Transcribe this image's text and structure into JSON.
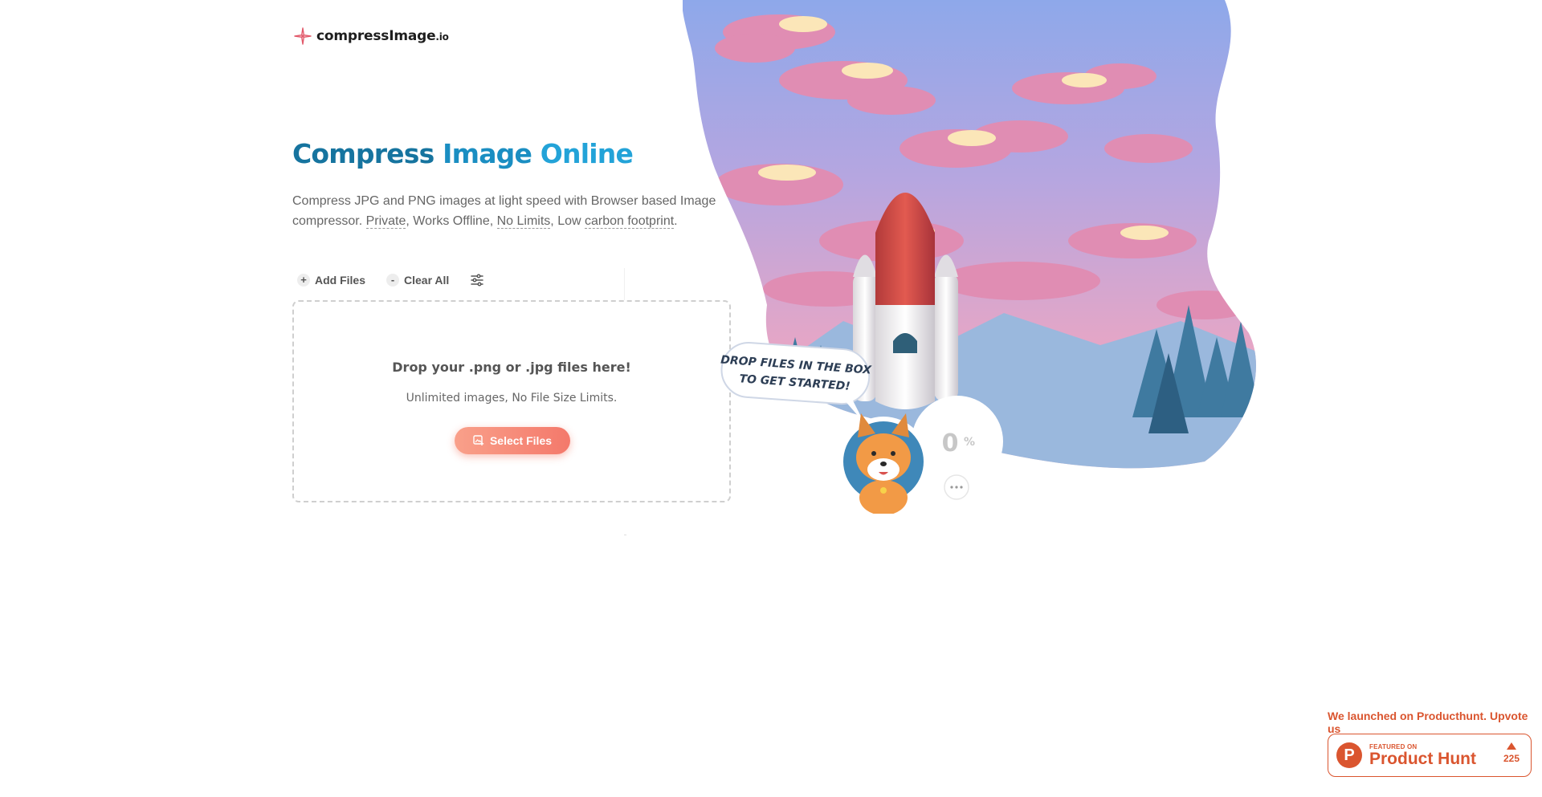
{
  "header": {
    "logo_name": "compressImage",
    "logo_tld": ".io",
    "logo_icon": "sparkle-icon"
  },
  "hero": {
    "title_word1": "Compress",
    "title_word2": "Image",
    "title_word3": "Online",
    "desc_1": "Compress JPG and PNG images at light speed with Browser based Image compressor. ",
    "desc_private": "Private",
    "desc_2": ", Works Offline, ",
    "desc_nolimits": "No Limits",
    "desc_3": ", Low ",
    "desc_carbon": "carbon footprint",
    "desc_4": "."
  },
  "toolbar": {
    "add_symbol": "+",
    "add_label": "Add Files",
    "clear_symbol": "-",
    "clear_label": "Clear All",
    "settings_icon": "sliders-icon"
  },
  "dropzone": {
    "title": "Drop your .png or .jpg files here!",
    "subtitle": "Unlimited images, No File Size Limits.",
    "select_label": "Select Files",
    "select_icon": "image-add-icon"
  },
  "illustration": {
    "bubble_line1": "DROP FILES IN THE BOX",
    "bubble_line2": "TO GET STARTED!",
    "progress_value": "0",
    "progress_unit": "%",
    "more_icon": "ellipsis-icon",
    "mascot": "corgi-mascot"
  },
  "producthunt": {
    "announce": "We launched on Producthunt. Upvote us",
    "badge_letter": "P",
    "featured": "FEATURED ON",
    "name": "Product Hunt",
    "votes": "225",
    "color": "#da552f"
  },
  "colors": {
    "title_dark": "#16749f",
    "title_mid": "#1a8ec2",
    "title_light": "#23a3d8",
    "button": "#f4796b",
    "accent": "#da552f"
  }
}
